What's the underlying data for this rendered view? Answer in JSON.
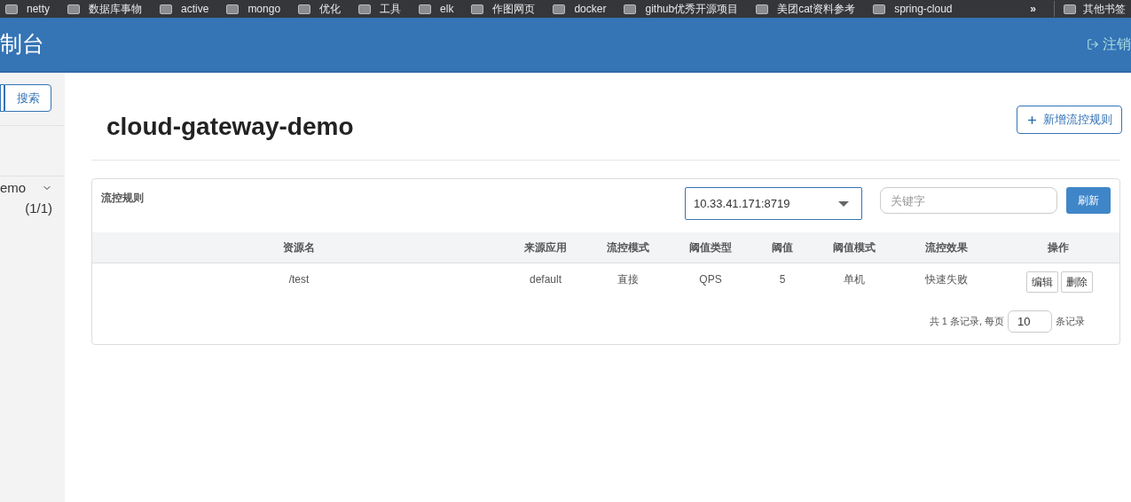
{
  "bookmarks": [
    {
      "label": "netty"
    },
    {
      "label": "数据库事物"
    },
    {
      "label": "active"
    },
    {
      "label": "mongo"
    },
    {
      "label": "优化"
    },
    {
      "label": "工具"
    },
    {
      "label": "elk"
    },
    {
      "label": "作图网页"
    },
    {
      "label": "docker"
    },
    {
      "label": "github优秀开源项目"
    },
    {
      "label": "美团cat资料参考"
    },
    {
      "label": "spring-cloud"
    }
  ],
  "bookmarks_more": "»",
  "bookmarks_other": "其他书签",
  "header": {
    "title": "制台",
    "logout": "注销"
  },
  "sidebar": {
    "search_button": "搜索",
    "app": {
      "name": "emo",
      "count": "(1/1)",
      "expanded": true
    }
  },
  "page": {
    "title": "cloud-gateway-demo",
    "add_button": "新增流控规则"
  },
  "panel": {
    "title": "流控规则",
    "machine": "10.33.41.171:8719",
    "search": {
      "placeholder": "关键字"
    },
    "refresh_button": "刷新",
    "table": {
      "columns": [
        "资源名",
        "来源应用",
        "流控模式",
        "阈值类型",
        "阈值",
        "阈值模式",
        "流控效果",
        "操作"
      ],
      "rows": [
        {
          "cells": [
            "/test",
            "default",
            "直接",
            "QPS",
            "5",
            "单机",
            "快速失败"
          ],
          "actions": [
            "编辑",
            "删除"
          ]
        }
      ]
    },
    "pagination": {
      "before": "共 1 条记录, 每页",
      "page_size": "10",
      "after": "条记录"
    }
  }
}
